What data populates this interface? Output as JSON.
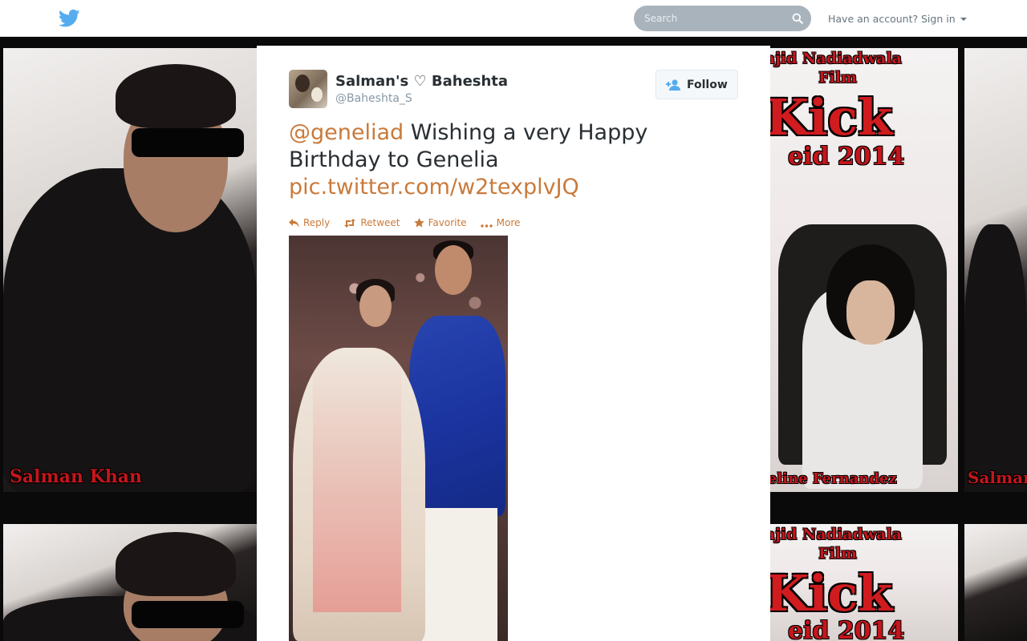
{
  "topbar": {
    "logo_icon": "twitter-bird-icon",
    "brand_color": "#55acee",
    "search": {
      "placeholder": "Search",
      "value": ""
    },
    "search_icon": "magnifier-icon",
    "have_account": "Have an account?",
    "sign_in": "Sign in",
    "sign_in_icon": "caret-down-icon"
  },
  "background": {
    "tiles": [
      {
        "caption": "Salman Khan"
      },
      {
        "caption": "Jacqueline Fernandez"
      }
    ],
    "kick_text": "Kick",
    "kick_subtitle": "eid 2014",
    "kick_header_line1": "Sajid Nadiadwala",
    "kick_header_line2": "Film"
  },
  "tweet": {
    "author": {
      "display_name": "Salman's ♡ Baheshta",
      "screen_name": "@Baheshta_S",
      "avatar_icon": "user-avatar"
    },
    "follow_button": {
      "label": "Follow",
      "icon": "follow-user-icon"
    },
    "text": {
      "mention": "@geneliad",
      "body": " Wishing a very Happy Birthday to Genelia ",
      "link": "pic.twitter.com/w2texplvJQ"
    },
    "link_color": "#c97a3b",
    "actions": [
      {
        "label": "Reply",
        "icon": "reply-icon"
      },
      {
        "label": "Retweet",
        "icon": "retweet-icon"
      },
      {
        "label": "Favorite",
        "icon": "star-icon"
      },
      {
        "label": "More",
        "icon": "more-dots-icon"
      }
    ],
    "media": {
      "type": "photo"
    }
  }
}
